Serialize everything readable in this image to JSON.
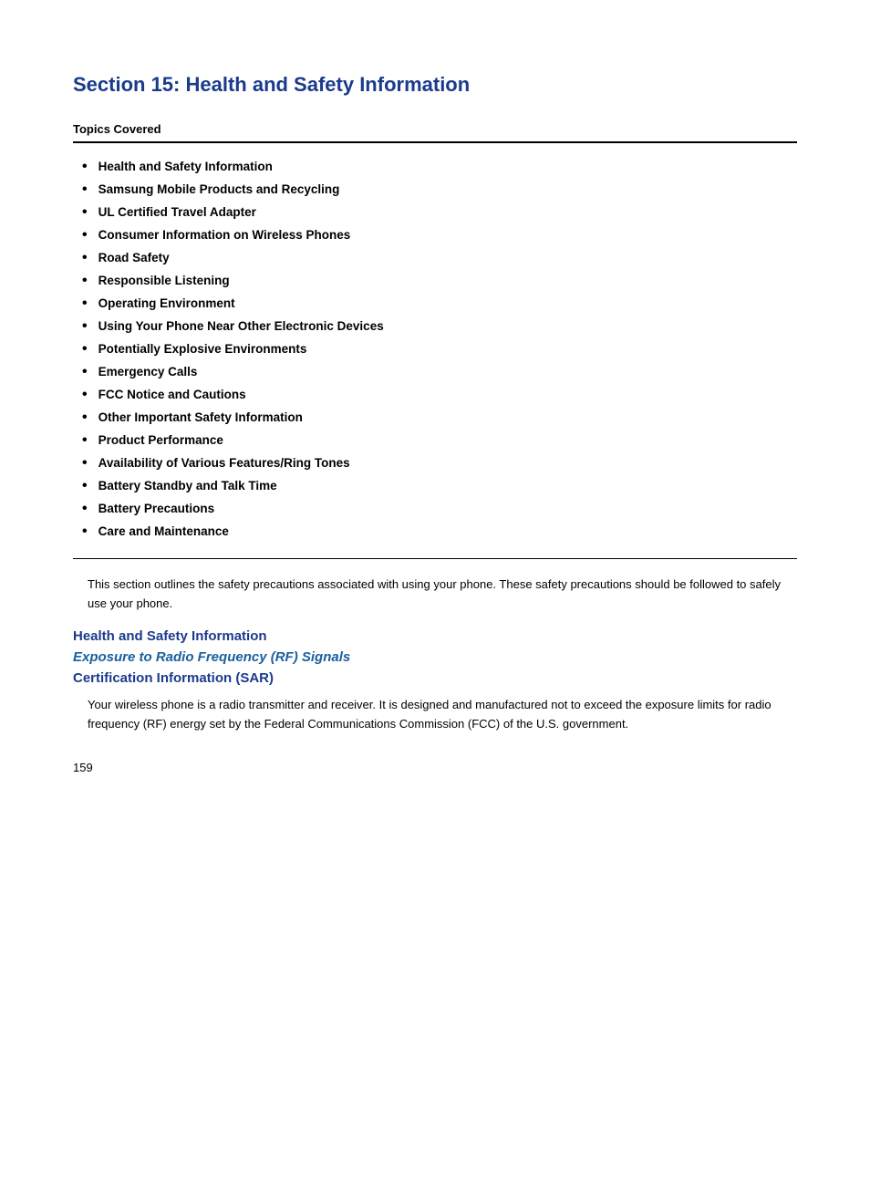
{
  "page": {
    "section_title": "Section 15: Health and Safety Information",
    "topics_header": "Topics Covered",
    "topics": [
      "Health and Safety Information",
      "Samsung Mobile Products and Recycling",
      "UL Certified Travel Adapter",
      "Consumer Information on Wireless Phones",
      "Road Safety",
      "Responsible Listening",
      "Operating Environment",
      "Using Your Phone Near Other Electronic Devices",
      "Potentially Explosive Environments",
      "Emergency Calls",
      "FCC Notice and Cautions",
      "Other Important Safety Information",
      "Product Performance",
      "Availability of Various Features/Ring Tones",
      "Battery Standby and Talk Time",
      "Battery Precautions",
      "Care and Maintenance"
    ],
    "intro_text": "This section outlines the safety precautions associated with using your phone. These safety precautions should be followed to safely use your phone.",
    "health_safety_heading": "Health and Safety Information",
    "rf_signals_heading": "Exposure to Radio Frequency (RF) Signals",
    "certification_heading": "Certification Information (SAR)",
    "certification_body": "Your wireless phone is a radio transmitter and receiver. It is designed and manufactured not to exceed the exposure limits for radio frequency (RF) energy set by the Federal Communications Commission (FCC) of the U.S. government.",
    "page_number": "159"
  }
}
